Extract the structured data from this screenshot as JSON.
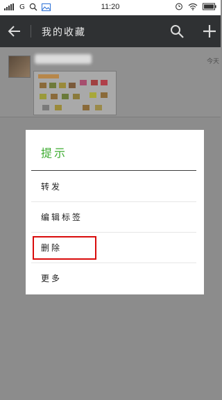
{
  "status_bar": {
    "network_label": "G",
    "time": "11:20"
  },
  "app_bar": {
    "title": "我的收藏"
  },
  "favorite_item": {
    "date_label": "今天"
  },
  "dialog": {
    "title": "提示",
    "options": [
      "转发",
      "编辑标签",
      "删除",
      "更多"
    ]
  },
  "colors": {
    "accent_green": "#3bab2f",
    "highlight_red": "#d90b0b",
    "app_bar_bg": "#2f3133"
  },
  "icons": [
    "signal-icon",
    "search-status-icon",
    "image-status-icon",
    "alarm-icon",
    "wifi-icon",
    "battery-icon",
    "back-arrow-icon",
    "search-icon",
    "add-icon"
  ]
}
